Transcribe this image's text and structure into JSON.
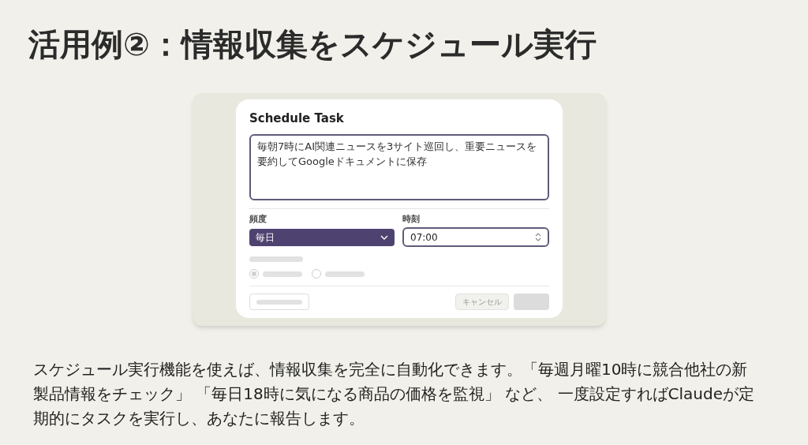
{
  "slide_title": "活用例②：情報収集をスケジュール実行",
  "dialog": {
    "title": "Schedule Task",
    "prompt": "毎朝7時にAI関連ニュースを3サイト巡回し、重要ニュースを要約してGoogleドキュメントに保存",
    "frequency": {
      "label": "頻度",
      "value": "毎日"
    },
    "time": {
      "label": "時刻",
      "value": "07:00"
    },
    "radios": [
      {
        "selected": true
      },
      {
        "selected": false
      }
    ],
    "cancel_button": "キャンセル"
  },
  "body_text": "スケジュール実行機能を使えば、情報収集を完全に自動化できます。「毎週月曜10時に競合他社の新製品情報をチェック」 「毎日18時に気になる商品の価格を監視」 など、 一度設定すればClaudeが定期的にタスクを実行し、あなたに報告します。"
}
